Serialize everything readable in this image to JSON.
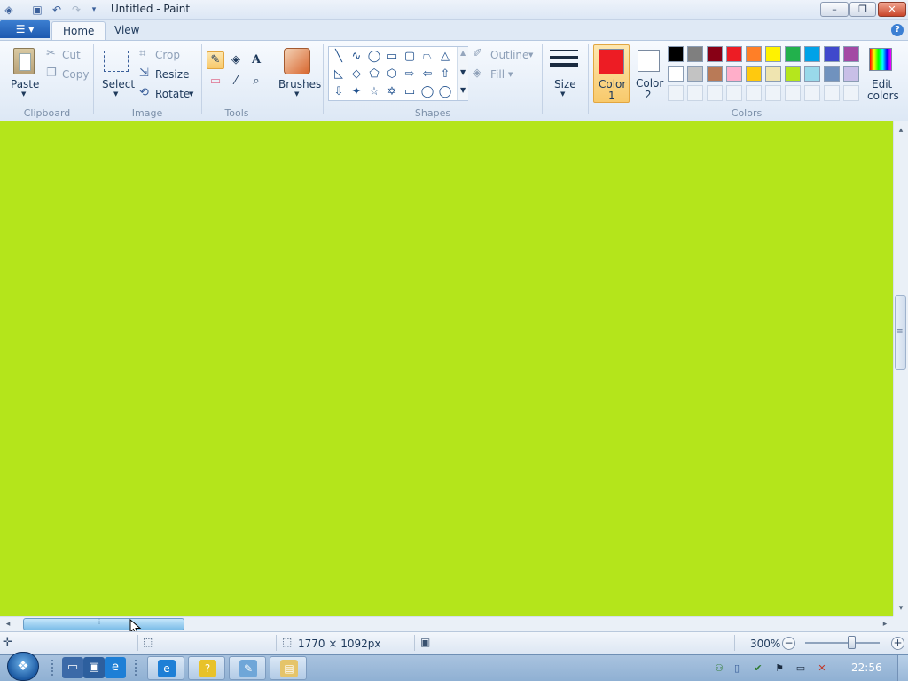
{
  "window": {
    "title": "Untitled - Paint",
    "controls": {
      "minimize": "–",
      "maximize": "❐",
      "close": "✕"
    },
    "quick_access": {
      "app_icon": "paint-icon",
      "save": "save-icon",
      "undo": "undo-icon",
      "redo": "redo-icon",
      "customize": "dropdown-icon"
    }
  },
  "ribbon_tabs": {
    "app_menu": "☰ ▾",
    "tabs": [
      {
        "label": "Home",
        "active": true
      },
      {
        "label": "View",
        "active": false
      }
    ],
    "help": "?"
  },
  "clipboard": {
    "paste": "Paste",
    "cut": "Cut",
    "copy": "Copy",
    "group": "Clipboard"
  },
  "image": {
    "select": "Select",
    "crop": "Crop",
    "resize": "Resize",
    "rotate": "Rotate",
    "group": "Image"
  },
  "tools": {
    "group": "Tools",
    "items": [
      {
        "name": "pencil-icon",
        "glyph": "✎",
        "selected": true
      },
      {
        "name": "fill-icon",
        "glyph": "◈",
        "selected": false
      },
      {
        "name": "text-icon",
        "glyph": "A",
        "selected": false
      },
      {
        "name": "eraser-icon",
        "glyph": "▭",
        "selected": false
      },
      {
        "name": "color-picker-icon",
        "glyph": "⁄",
        "selected": false
      },
      {
        "name": "magnifier-icon",
        "glyph": "⌕",
        "selected": false
      }
    ]
  },
  "brushes": {
    "label": "Brushes"
  },
  "shapes": {
    "group": "Shapes",
    "outline": "Outline",
    "fill": "Fill",
    "items": [
      "╲",
      "∿",
      "◯",
      "▭",
      "▢",
      "⏢",
      "△",
      "◺",
      "◇",
      "⬠",
      "⬡",
      "⇨",
      "⇦",
      "⇧",
      "⇩",
      "✦",
      "☆",
      "✡",
      "▭",
      "◯",
      "◯"
    ]
  },
  "size": {
    "label": "Size"
  },
  "colors": {
    "group": "Colors",
    "color1": {
      "label_line1": "Color",
      "label_line2": "1",
      "value": "#ed1c24"
    },
    "color2": {
      "label_line1": "Color",
      "label_line2": "2",
      "value": "#ffffff"
    },
    "edit": {
      "line1": "Edit",
      "line2": "colors"
    },
    "palette_row1": [
      "#000000",
      "#7f7f7f",
      "#880015",
      "#ed1c24",
      "#ff7f27",
      "#fff200",
      "#22b14c",
      "#00a2e8",
      "#3f48cc",
      "#a349a4"
    ],
    "palette_row2": [
      "#ffffff",
      "#c3c3c3",
      "#b97a57",
      "#ffaec9",
      "#ffc90e",
      "#efe4b0",
      "#b5e61d",
      "#99d9ea",
      "#7092be",
      "#c8bfe7"
    ],
    "palette_row3": [
      "",
      "",
      "",
      "",
      "",
      "",
      "",
      "",
      "",
      ""
    ]
  },
  "canvas": {
    "color": "#b4e51b"
  },
  "scrollbars": {
    "up": "▴",
    "down": "▾",
    "left": "◂",
    "right": "▸",
    "grip": "≡"
  },
  "statusbar": {
    "size_text": "1770 × 1092px",
    "zoom": "300%",
    "zoom_out": "−",
    "zoom_in": "+",
    "zoom_level_pct": 60
  },
  "taskbar": {
    "start": "❖",
    "pinned": [
      {
        "name": "show-desktop-icon",
        "glyph": "▭"
      },
      {
        "name": "switch-windows-icon",
        "glyph": "▣"
      },
      {
        "name": "internet-explorer-icon",
        "glyph": "e"
      }
    ],
    "tasks": [
      {
        "name": "internet-explorer-task",
        "glyph": "e"
      },
      {
        "name": "help-task",
        "glyph": "?"
      },
      {
        "name": "paint-task",
        "glyph": "✎"
      },
      {
        "name": "explorer-task",
        "glyph": "▤"
      }
    ],
    "tray": [
      {
        "name": "network-icon",
        "glyph": "⚇"
      },
      {
        "name": "document-icon",
        "glyph": "▯"
      },
      {
        "name": "security-icon",
        "glyph": "✔"
      },
      {
        "name": "flag-icon",
        "glyph": "⚑"
      },
      {
        "name": "monitor-icon",
        "glyph": "▭"
      },
      {
        "name": "volume-muted-icon",
        "glyph": "✕"
      }
    ],
    "clock": "22:56"
  }
}
